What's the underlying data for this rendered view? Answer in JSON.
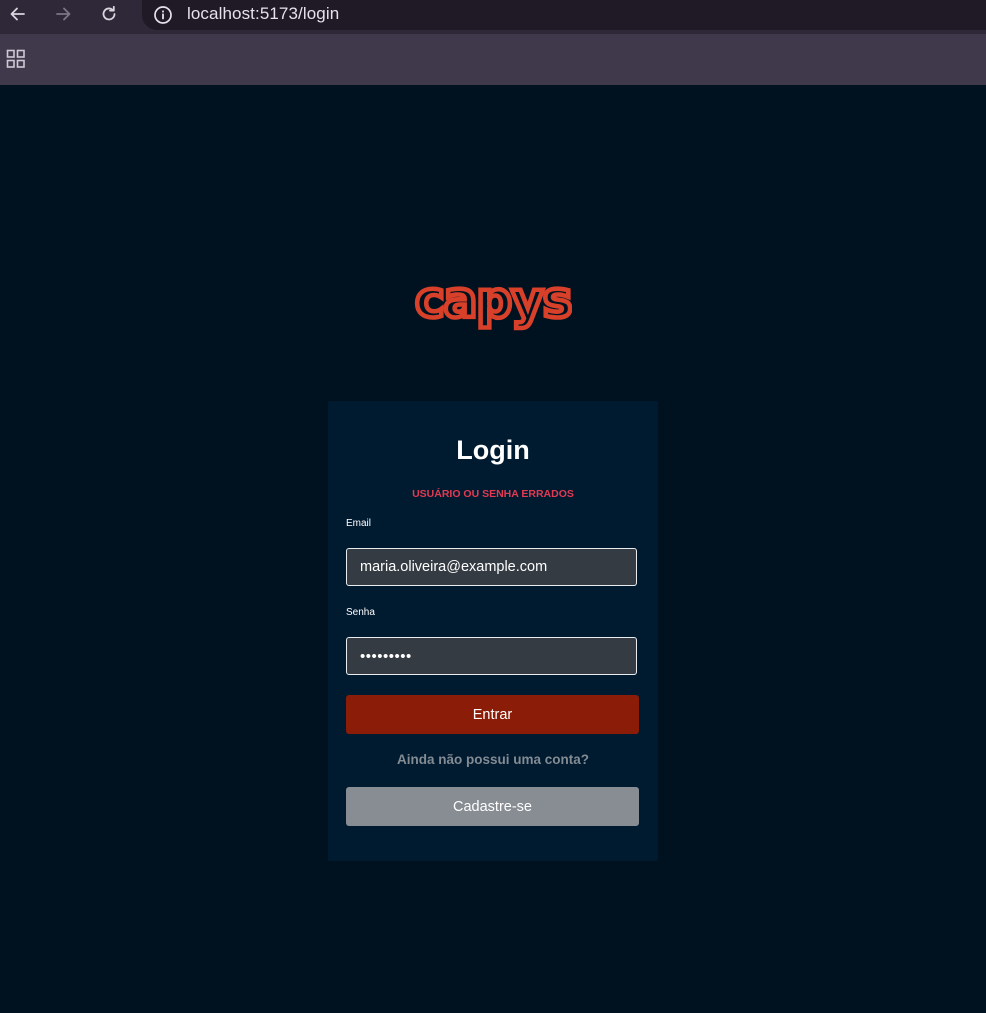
{
  "browser": {
    "url": "localhost:5173/login",
    "icons": {
      "back": "arrow-left-icon",
      "forward": "arrow-right-icon",
      "reload": "reload-icon",
      "site_info": "info-icon",
      "apps": "apps-grid-icon"
    }
  },
  "brand": {
    "logo_text": "capys",
    "logo_color": "#d8402a"
  },
  "login": {
    "title": "Login",
    "error": "USUÁRIO OU SENHA ERRADOS",
    "email_label": "Email",
    "email_value": "maria.oliveira@example.com",
    "password_label": "Senha",
    "password_value": "•••••••••",
    "submit_label": "Entrar",
    "signup_prompt": "Ainda não possui uma conta?",
    "signup_label": "Cadastre-se"
  },
  "colors": {
    "page_background": "#00121f",
    "card_background": "#001a30",
    "error": "#e23a52",
    "primary_button": "#8b1c08",
    "secondary_button": "#878d93"
  }
}
